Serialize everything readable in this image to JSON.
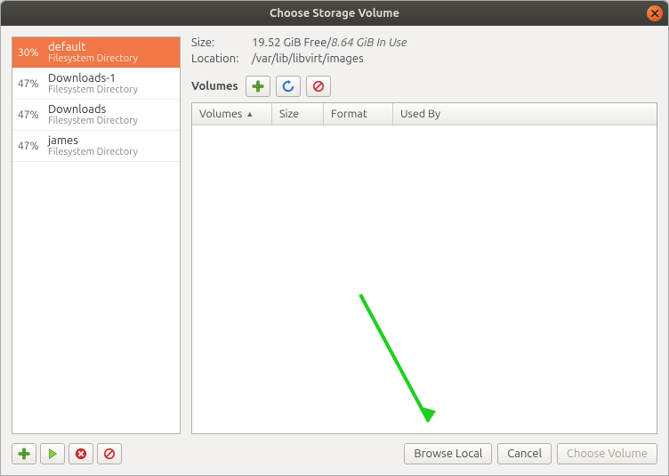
{
  "window": {
    "title": "Choose Storage Volume"
  },
  "sidebar": {
    "pools": [
      {
        "pct": "30%",
        "name": "default",
        "type": "Filesystem Directory",
        "selected": true
      },
      {
        "pct": "47%",
        "name": "Downloads-1",
        "type": "Filesystem Directory",
        "selected": false
      },
      {
        "pct": "47%",
        "name": "Downloads",
        "type": "Filesystem Directory",
        "selected": false
      },
      {
        "pct": "47%",
        "name": "james",
        "type": "Filesystem Directory",
        "selected": false
      }
    ]
  },
  "details": {
    "size_label": "Size:",
    "size_free": "19.52 GiB Free",
    "size_sep": " / ",
    "size_used": "8.64 GiB In Use",
    "location_label": "Location:",
    "location_value": "/var/lib/libvirt/images",
    "volumes_label": "Volumes",
    "columns": {
      "volumes": "Volumes",
      "size": "Size",
      "format": "Format",
      "used_by": "Used By"
    }
  },
  "footer": {
    "browse_local": "Browse Local",
    "cancel": "Cancel",
    "choose_volume": "Choose Volume"
  }
}
